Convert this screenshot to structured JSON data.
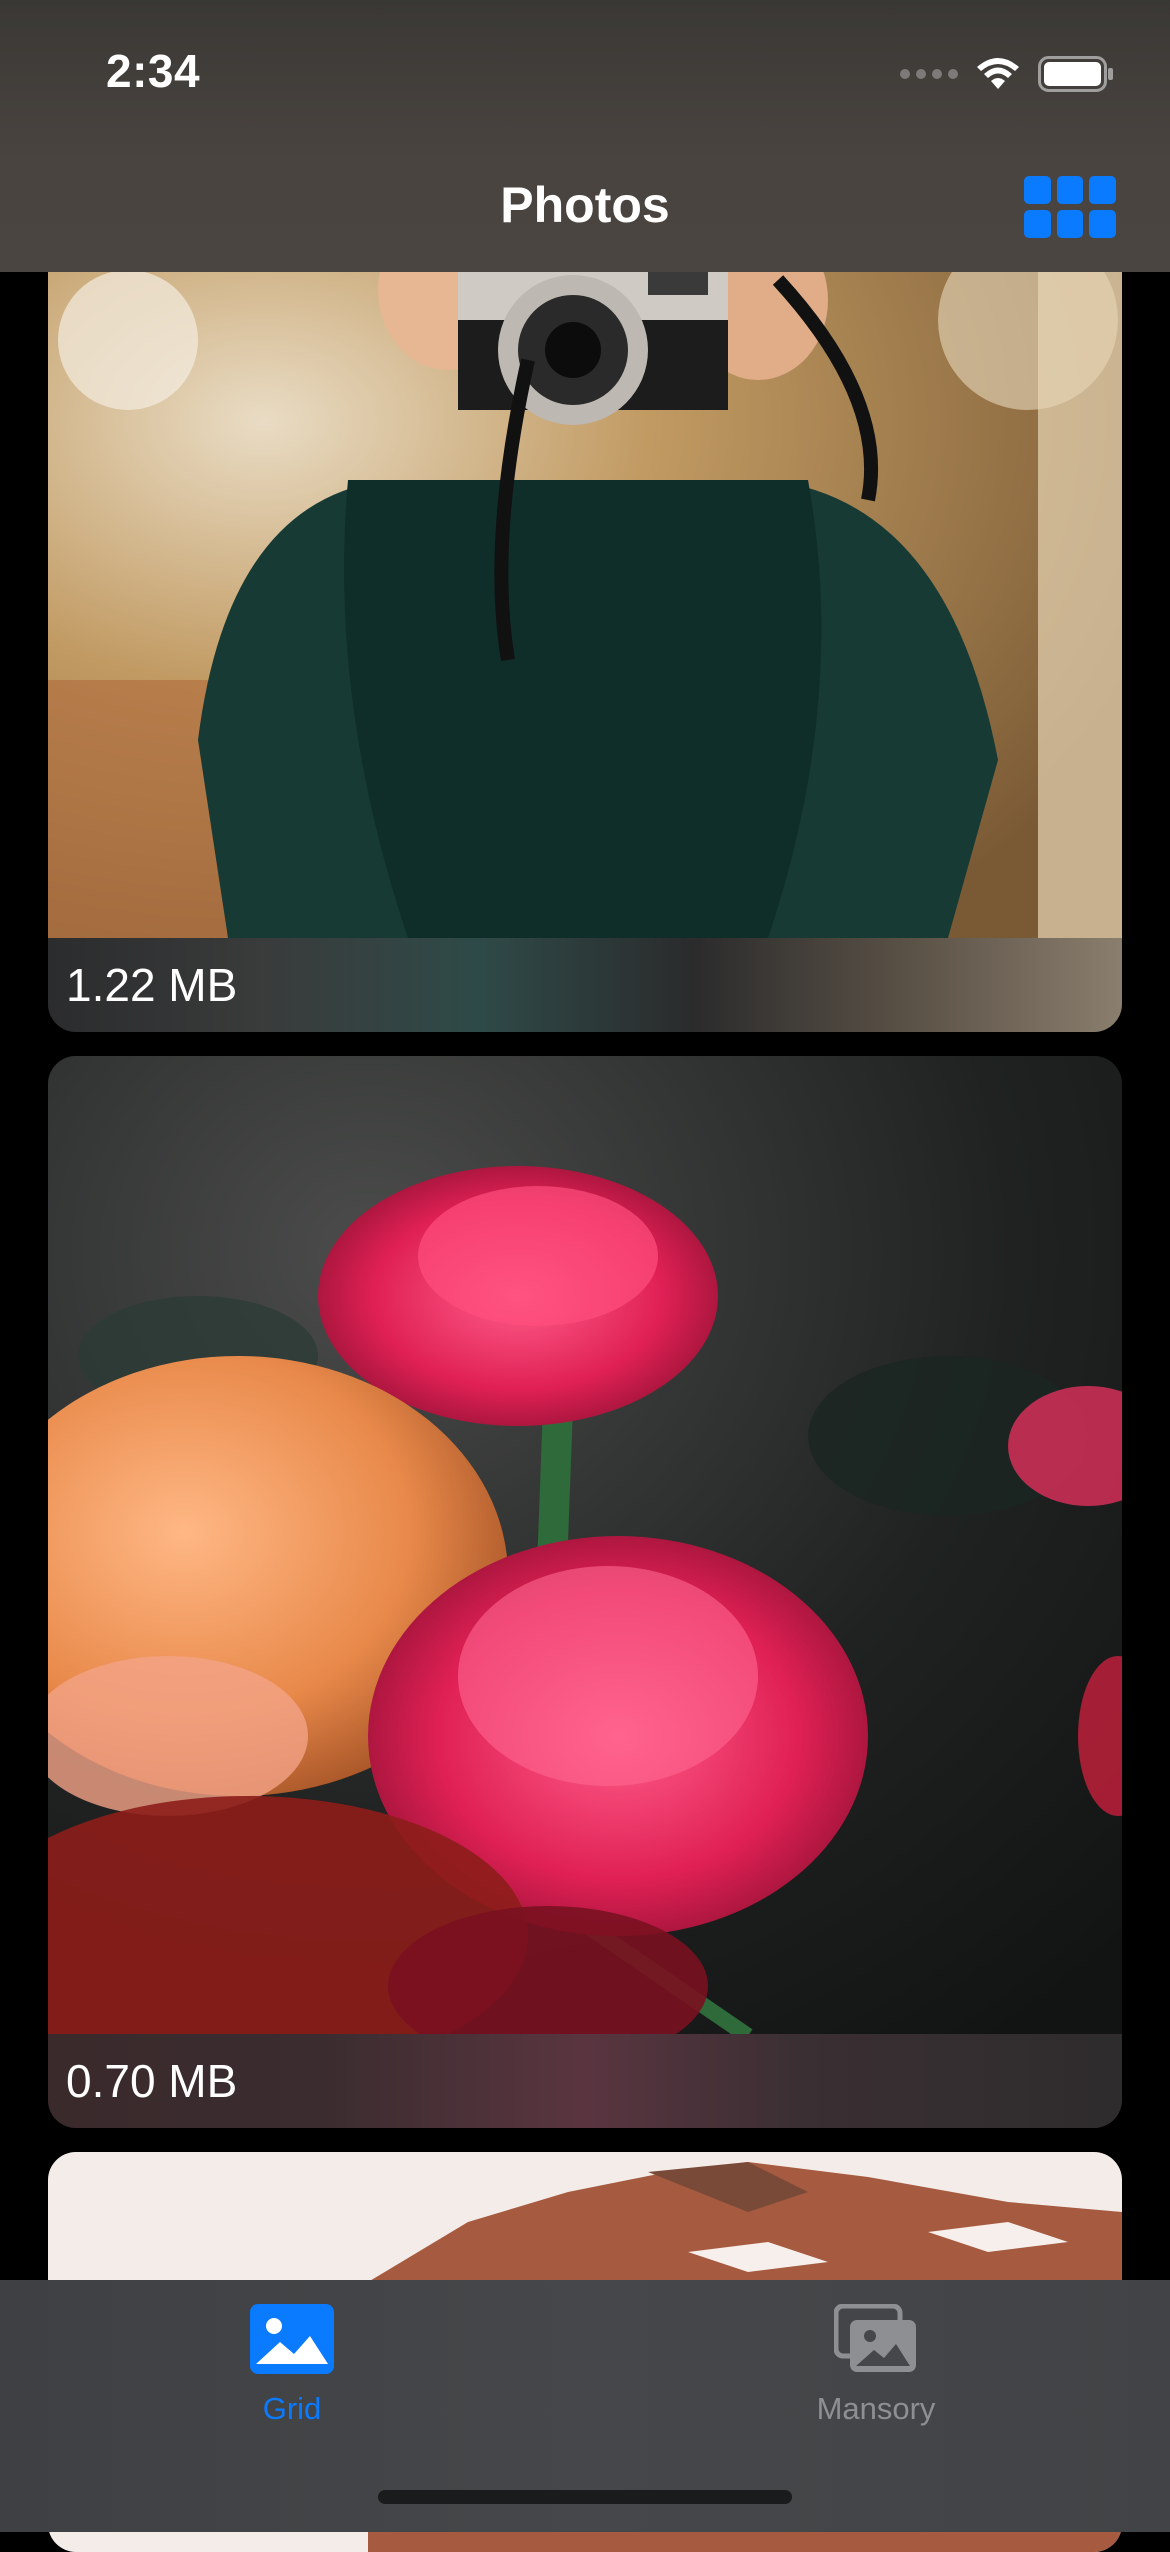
{
  "status_bar": {
    "time": "2:34"
  },
  "nav": {
    "title": "Photos",
    "layout_toggle_icon": "grid-icon"
  },
  "photos": [
    {
      "size": "1.22 MB",
      "subject": "person holding camera"
    },
    {
      "size": "0.70 MB",
      "subject": "pink and orange roses"
    },
    {
      "size": "",
      "subject": "mountain peaks"
    }
  ],
  "tabs": [
    {
      "label": "Grid",
      "icon": "photo-icon",
      "selected": true
    },
    {
      "label": "Mansory",
      "icon": "photo-stack-icon",
      "selected": false
    }
  ],
  "colors": {
    "accent": "#0a7aff",
    "inactive_tab": "#8d8f92"
  }
}
